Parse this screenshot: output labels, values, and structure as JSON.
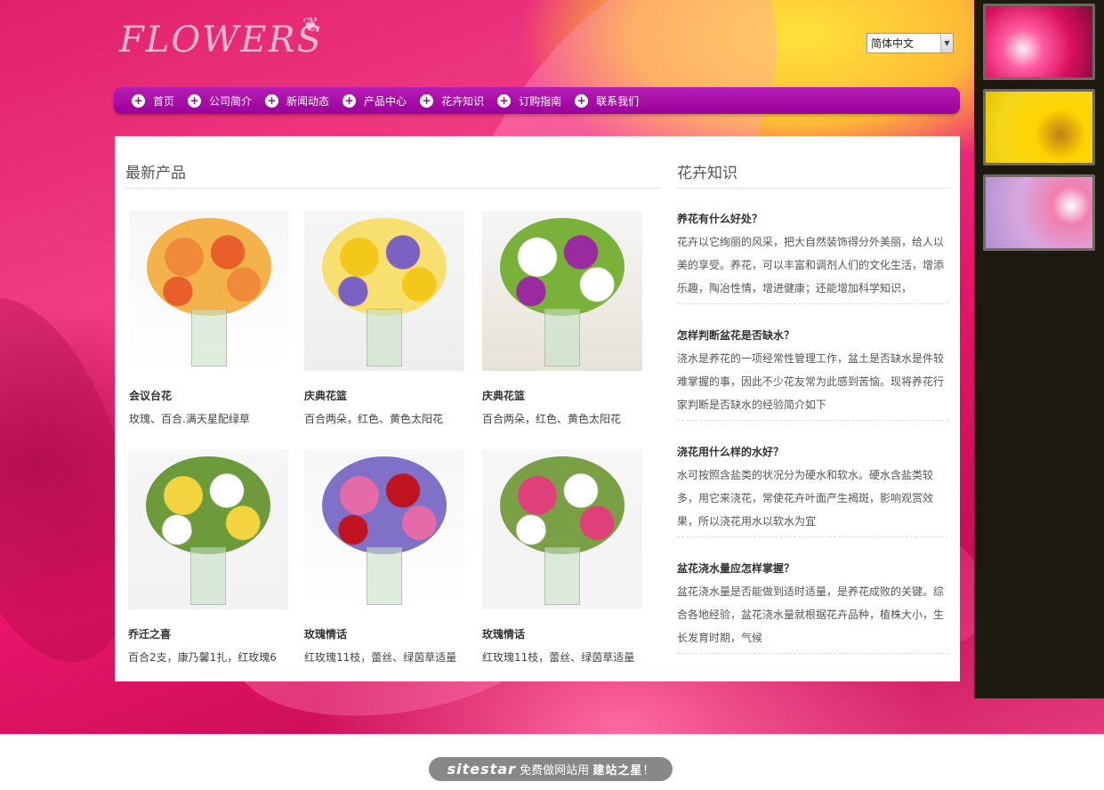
{
  "logo": {
    "text": "FLOWERS"
  },
  "language": {
    "selected": "简体中文"
  },
  "nav": {
    "items": [
      {
        "label": "首页"
      },
      {
        "label": "公司简介"
      },
      {
        "label": "新闻动态"
      },
      {
        "label": "产品中心"
      },
      {
        "label": "花卉知识"
      },
      {
        "label": "订购指南"
      },
      {
        "label": "联系我们"
      }
    ]
  },
  "products": {
    "title": "最新产品",
    "items": [
      {
        "name": "会议台花",
        "desc": "玫瑰、百合.满天星配绿草",
        "palette": [
          "#f08a3a",
          "#e85f2c",
          "#f3b24a",
          "#ffffff"
        ]
      },
      {
        "name": "庆典花篮",
        "desc": "百合两朵，红色、黄色太阳花",
        "palette": [
          "#f4c81a",
          "#7b62c2",
          "#f7e070",
          "#eeeeee"
        ]
      },
      {
        "name": "庆典花篮",
        "desc": "百合两朵，红色、黄色太阳花",
        "palette": [
          "#ffffff",
          "#9a2aa0",
          "#7ab13a",
          "#e7e2d8"
        ]
      },
      {
        "name": "乔迁之喜",
        "desc": "百合2支，康乃馨1扎，红玫瑰6",
        "palette": [
          "#f3d340",
          "#ffffff",
          "#6d9a3a",
          "#f2f2f2"
        ]
      },
      {
        "name": "玫瑰情话",
        "desc": "红玫瑰11枝，蕾丝、绿茵草适量",
        "palette": [
          "#e56aa8",
          "#c01420",
          "#8070c8",
          "#ffffff"
        ]
      },
      {
        "name": "玫瑰情话",
        "desc": "红玫瑰11枝，蕾丝、绿茵草适量",
        "palette": [
          "#e0407a",
          "#ffffff",
          "#7aa045",
          "#f4f4f4"
        ]
      }
    ]
  },
  "knowledge": {
    "title": "花卉知识",
    "articles": [
      {
        "q": "养花有什么好处？",
        "a": "花卉以它绚丽的风采，把大自然装饰得分外美丽，给人以美的享受。养花，可以丰富和调剂人们的文化生活，增添乐趣，陶冶性情，增进健康；还能增加科学知识，"
      },
      {
        "q": "怎样判断盆花是否缺水？",
        "a": "浇水是养花的一项经常性管理工作，盆土是否缺水是件较难掌握的事，因此不少花友常为此感到苦恼。现将养花行家判断是否缺水的经验简介如下"
      },
      {
        "q": "浇花用什么样的水好？",
        "a": "水可按照含盐类的状况分为硬水和软水。硬水含盐类较多，用它来浇花，常使花卉叶面产生褐斑，影响观赏效果，所以浇花用水以软水为宜"
      },
      {
        "q": "盆花浇水量应怎样掌握？",
        "a": "盆花浇水量是否能做到适时适量，是养花成败的关键。综合各地经验，盆花浇水量就根据花卉品种，植株大小，生长发育时期，气候"
      }
    ]
  },
  "footer": {
    "brand": "sitestar",
    "text": "免费做网站用",
    "highlight": "建站之星",
    "end": "！"
  },
  "colors": {
    "nav": "#9a009a",
    "bg": "#e0206a"
  }
}
